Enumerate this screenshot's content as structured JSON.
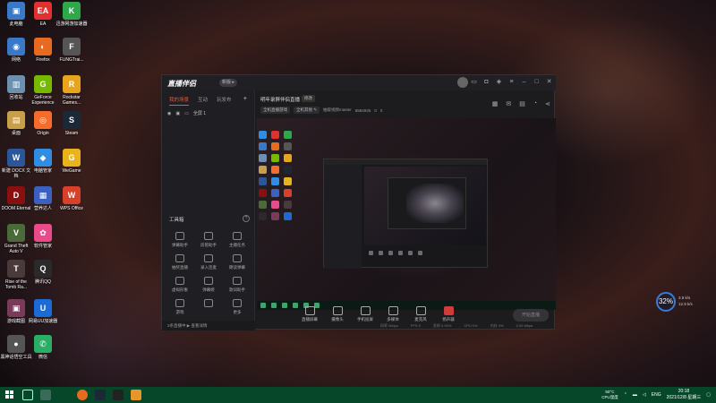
{
  "desktop": {
    "icons": [
      {
        "label": "此电脑",
        "glyph": "▣",
        "color": "#3a78c8"
      },
      {
        "label": "EA",
        "glyph": "EA",
        "color": "#e03030"
      },
      {
        "label": "迅游网游加速器",
        "glyph": "K",
        "color": "#2ea84a"
      },
      {
        "label": "网络",
        "glyph": "◉",
        "color": "#3a78c8"
      },
      {
        "label": "Firefox",
        "glyph": "◐",
        "color": "#e66a1f"
      },
      {
        "label": "FLiNGTrai...",
        "glyph": "F",
        "color": "#555"
      },
      {
        "label": "回收站",
        "glyph": "▥",
        "color": "#6d8fb0"
      },
      {
        "label": "GeForce Experience",
        "glyph": "G",
        "color": "#76b900"
      },
      {
        "label": "Rockstar Games...",
        "glyph": "R",
        "color": "#e8a41c"
      },
      {
        "label": "桌面",
        "glyph": "▤",
        "color": "#c8a04a"
      },
      {
        "label": "Origin",
        "glyph": "◎",
        "color": "#f56c2d"
      },
      {
        "label": "Steam",
        "glyph": "S",
        "color": "#1b2838"
      },
      {
        "label": "新建 DOCX 文档",
        "glyph": "W",
        "color": "#2b579a"
      },
      {
        "label": "电脑管家",
        "glyph": "◆",
        "color": "#2f8de4"
      },
      {
        "label": "WeGame",
        "glyph": "G",
        "color": "#e8b31c"
      },
      {
        "label": "DOOM Eternal",
        "glyph": "D",
        "color": "#8a1010"
      },
      {
        "label": "营养达人",
        "glyph": "▦",
        "color": "#3a60c0"
      },
      {
        "label": "WPS Office",
        "glyph": "W",
        "color": "#d8402a"
      },
      {
        "label": "Grand Theft Auto V",
        "glyph": "V",
        "color": "#4a6a3a"
      },
      {
        "label": "软件管家",
        "glyph": "✿",
        "color": "#e84a8a"
      },
      {
        "label": "Rise of the Tomb Ra...",
        "glyph": "T",
        "color": "#4a3a3a"
      },
      {
        "label": "腾讯QQ",
        "glyph": "Q",
        "color": "#2a2a2a"
      },
      {
        "label": "游戏截图",
        "glyph": "▣",
        "color": "#7a3a5a"
      },
      {
        "label": "网易UU加速器",
        "glyph": "U",
        "color": "#1a6ad8"
      },
      {
        "label": "黑神话悟空工具",
        "glyph": "●",
        "color": "#555"
      },
      {
        "label": "微信",
        "glyph": "✆",
        "color": "#2aae67"
      }
    ]
  },
  "app": {
    "logo": "直播伴侣",
    "badge": "新版 ▸",
    "left_tabs": [
      "我的场景",
      "互动",
      "玩发布"
    ],
    "add": "+",
    "scene_name": "全屏 1",
    "tools_title": "工具箱",
    "tools": [
      {
        "label": "弹幕助手"
      },
      {
        "label": "房管助手"
      },
      {
        "label": "主播任务"
      },
      {
        "label": "抽奖直播"
      },
      {
        "label": "录入连麦"
      },
      {
        "label": "朗读弹幕"
      },
      {
        "label": "虚拟形象"
      },
      {
        "label": "弹幕姬"
      },
      {
        "label": "歌词助手"
      },
      {
        "label": "游戏"
      },
      {
        "label": ""
      },
      {
        "label": "更多"
      }
    ],
    "ops_text": "2条直播中 ▶ 查看详情",
    "room": {
      "title": "明年录屏伴侣直播",
      "tag": "修改",
      "chips": [
        "全机直播游戏",
        "全机其他 ✎",
        "抽取视频master",
        "6584935",
        "0",
        "0"
      ]
    },
    "controls": [
      {
        "label": "直播屏幕"
      },
      {
        "label": "摄像头"
      },
      {
        "label": "手机投屏"
      },
      {
        "label": "多媒体"
      },
      {
        "label": "麦克风"
      },
      {
        "label": "扬声器"
      }
    ],
    "start_button": "开始直播",
    "stats": [
      "码率 0kbps",
      "FPS 0",
      "丢帧 0.00%",
      "CPU 0%",
      "内存 0%",
      "0.00 Mbps"
    ]
  },
  "widget": {
    "percent": "32%",
    "up": "3.9 k/s",
    "down": "12.9 k/s"
  },
  "taskbar": {
    "temp": "50°C",
    "temp_label": "CPU温度",
    "lang": "ENG",
    "time": "20:18",
    "date": "2021/12/8 星期三"
  }
}
